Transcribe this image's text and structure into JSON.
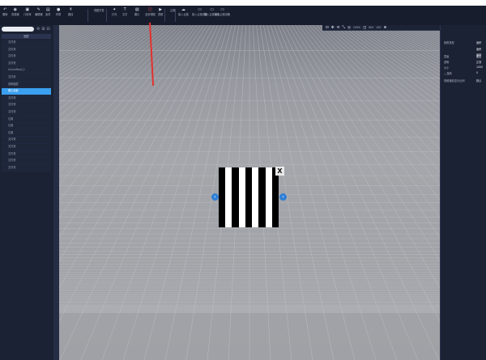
{
  "toolbar": {
    "items": [
      {
        "label": "撤销",
        "icon": "undo-icon"
      },
      {
        "label": "查看器",
        "icon": "eye-icon"
      },
      {
        "label": "几何体",
        "icon": "cube-icon"
      },
      {
        "label": "编辑器",
        "icon": "edit-icon"
      },
      {
        "label": "素材",
        "icon": "folder-icon"
      },
      {
        "label": "材质",
        "icon": "sphere-icon"
      },
      {
        "label": "路径",
        "icon": "path-icon"
      },
      {
        "label": "视图开发",
        "icon": ""
      },
      {
        "label": "灯光",
        "icon": "light-icon"
      },
      {
        "label": "文字",
        "icon": "text-icon"
      },
      {
        "label": "图片",
        "icon": "image-icon"
      },
      {
        "label": "全景视图",
        "icon": "panorama-icon"
      },
      {
        "label": "视频",
        "icon": "video-icon"
      },
      {
        "label": "云端",
        "icon": ""
      },
      {
        "label": "接入云端",
        "icon": "cloud-icon"
      },
      {
        "label": "接入云端设备",
        "icon": "device-icon"
      },
      {
        "label": "接入云端设备",
        "icon": "device-icon"
      },
      {
        "label": "接入云端设备",
        "icon": "device-icon"
      }
    ]
  },
  "left_panel": {
    "header": "图层",
    "rows": [
      "文件夹",
      "文件夹",
      "文件夹",
      "文件夹",
      "SceneRoot_0",
      "文件夹",
      "透明图层",
      "图片面板",
      "文件夹",
      "文件夹",
      "文件夹",
      "位置",
      "位置",
      "位置",
      "文件夹",
      "文件夹",
      "文件夹",
      "文件夹",
      "文件夹"
    ],
    "selected_index": 7
  },
  "viewport_bar": {
    "items": [
      "⊡",
      "✥",
      "⟲",
      "⤡",
      "◎",
      "100%",
      "◫",
      "800",
      "100",
      "⊕"
    ]
  },
  "right_panel": {
    "rows": [
      {
        "label": "吸附类型",
        "value": "面积"
      },
      {
        "label": "",
        "value": "面积"
      },
      {
        "label": "",
        "value": "面积"
      },
      {
        "label": "层级",
        "value": "图层"
      },
      {
        "label": "透明",
        "value": "正常"
      },
      {
        "label": "大小",
        "value": "1000"
      },
      {
        "label": "△ 旋转",
        "value": "0"
      },
      {
        "label": "视频播放显示比例",
        "value": "默认"
      }
    ]
  },
  "popup": {
    "close_label": "X",
    "prev_label": "‹",
    "next_label": "›"
  },
  "colors": {
    "stripe_dark": "#000000",
    "stripe_light": "#ffffff",
    "accent": "#3aa0ef",
    "annotation": "#e3322f"
  }
}
